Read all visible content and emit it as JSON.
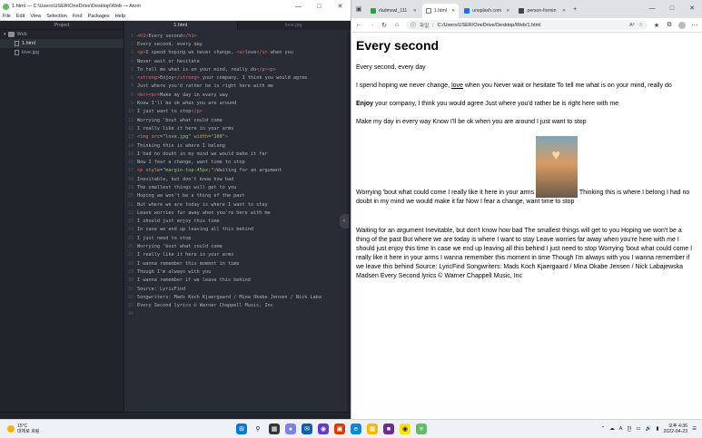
{
  "atom": {
    "title": "1.html — C:\\Users\\USER\\OneDrive\\Desktop\\Web — Atom",
    "menu": [
      "File",
      "Edit",
      "View",
      "Selection",
      "Find",
      "Packages",
      "Help"
    ],
    "tree_header": "Project",
    "tree": [
      {
        "name": "Web",
        "type": "folder"
      },
      {
        "name": "1.html",
        "type": "file",
        "selected": true
      },
      {
        "name": "love.jpg",
        "type": "file",
        "selected": false
      }
    ],
    "tabs": [
      {
        "label": "1.html",
        "active": true
      },
      {
        "label": "love.jpg",
        "active": false
      }
    ],
    "code_lines": [
      "<h1>Every second</h1>",
      "Every second, every day",
      "<p>I spend hoping we never change, <u>love</u> when you",
      "Never wait or hesitate",
      "To tell me what is on your mind, really do</p><p>",
      "<strong>Enjoy</strong> your company, I think you would agree",
      "Just where you'd rather be is right here with me",
      "<br><br>Make my day in every way",
      "Know I'll be ok when you are around",
      "I just want to stop</p>",
      "Worrying 'bout what could come",
      "I really like it here in your arms",
      "<img src=\"love.jpg\" width=\"100\">",
      "Thinking this is where I belong",
      "I had no doubt in my mind we would make it far",
      "Now I fear a change, want time to stop",
      "<p style=\"margin-top:45px;\">Waiting for an argument",
      "Inevitable, but don't know how bad",
      "The smallest things will get to you",
      "Hoping we won't be a thing of the past",
      "But where we are today is where I want to stay",
      "Leave worries far away when you're here with me",
      "I should just enjoy this time",
      "In case we end up leaving all this behind",
      "I just need to stop",
      "Worrying 'bout what could come",
      "I really like it here in your arms",
      "I wanna remember this moment in time",
      "Though I'm always with you",
      "I wanna remember if we leave this behind",
      "Source: LyricFind",
      "Songwriters: Mads Koch Kjaergaard / Mina Okabe Jensen / Nick Laba",
      "Every Second lyrics © Warner Chappell Music, Inc",
      ""
    ]
  },
  "edge": {
    "tabs": [
      {
        "label": "rladmswl_111 ",
        "color": "#2ea043"
      },
      {
        "label": "1.html",
        "color": "#ffffff",
        "active": true
      },
      {
        "label": "unsplash.com",
        "color": "#1a73e8"
      },
      {
        "label": "person-formin ",
        "color": "#444444"
      }
    ],
    "address_label": "파일",
    "address": "C:/Users/USER/OneDrive/Desktop/Web/1.html",
    "page": {
      "h1": "Every second",
      "p1": "Every second, every day",
      "p2_pre": "I spend hoping we never change, ",
      "p2_u": "love",
      "p2_post": " when you Never wait or hesitate To tell me what is on your mind, really do",
      "p3_strong": "Enjoy",
      "p3_rest": " your company, I think you would agree Just where you'd rather be is right here with me",
      "p3_br": "Make my day in every way Know I'll be ok when you are around I just want to stop",
      "p4_pre": "Worrying 'bout what could come I really like it here in your arms ",
      "p4_post": " Thinking this is where I belong I had no doubt in my mind we would make it far Now I fear a change, want time to stop",
      "p5": "Waiting for an argument Inevitable, but don't know how bad The smallest things will get to you Hoping we won't be a thing of the past But where we are today is where I want to stay Leave worries far away when you're here with me I should just enjoy this time In case we end up leaving all this behind I just need to stop Worrying 'bout what could come I really like it here in your arms I wanna remember this moment in time Though I'm always with you I wanna remember if we leave this behind Source: LyricFind Songwriters: Mads Koch Kjaergaard / Mina Okabe Jensen / Nick Labajewska Madsen Every Second lyrics © Warner Chappell Music, Inc"
    }
  },
  "taskbar": {
    "weather_temp": "15°C",
    "weather_desc": "대체로 흐림",
    "ime_lang": "A",
    "ime_mode": "한",
    "time": "오후 4:36",
    "date": "2022-04-23"
  }
}
